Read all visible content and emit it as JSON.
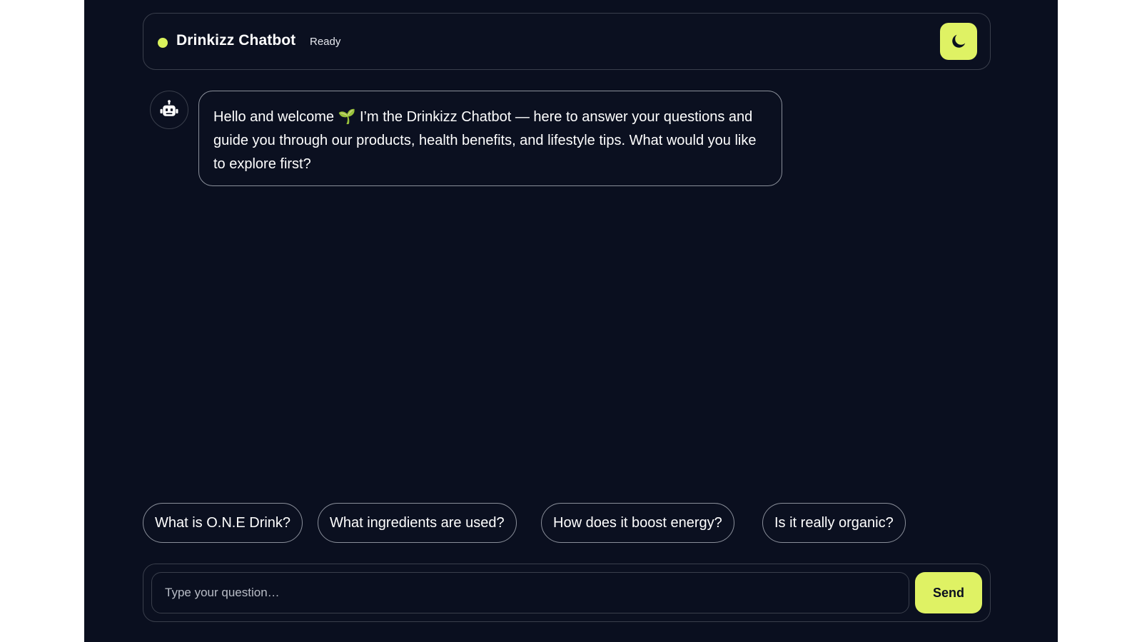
{
  "header": {
    "title": "Drinkizz Chatbot",
    "status": "Ready",
    "theme_toggle_icon": "moon-icon"
  },
  "messages": [
    {
      "sender": "bot",
      "avatar_icon": "robot-icon",
      "text_before_emoji": "Hello and welcome ",
      "emoji": "🌱",
      "text_after_emoji": " I’m the Drinkizz Chatbot — here to answer your questions and guide you through our products, health benefits, and lifestyle tips. What would you like to explore first?"
    }
  ],
  "suggestions": [
    "What is O.N.E Drink?",
    "What ingredients are used?",
    "How does it boost energy?",
    "Is it really organic?"
  ],
  "composer": {
    "placeholder": "Type your question…",
    "value": "",
    "send_label": "Send"
  },
  "colors": {
    "background": "#0a0f1f",
    "accent": "#dff264",
    "border": "#3a3f4c",
    "text": "#ffffff"
  }
}
